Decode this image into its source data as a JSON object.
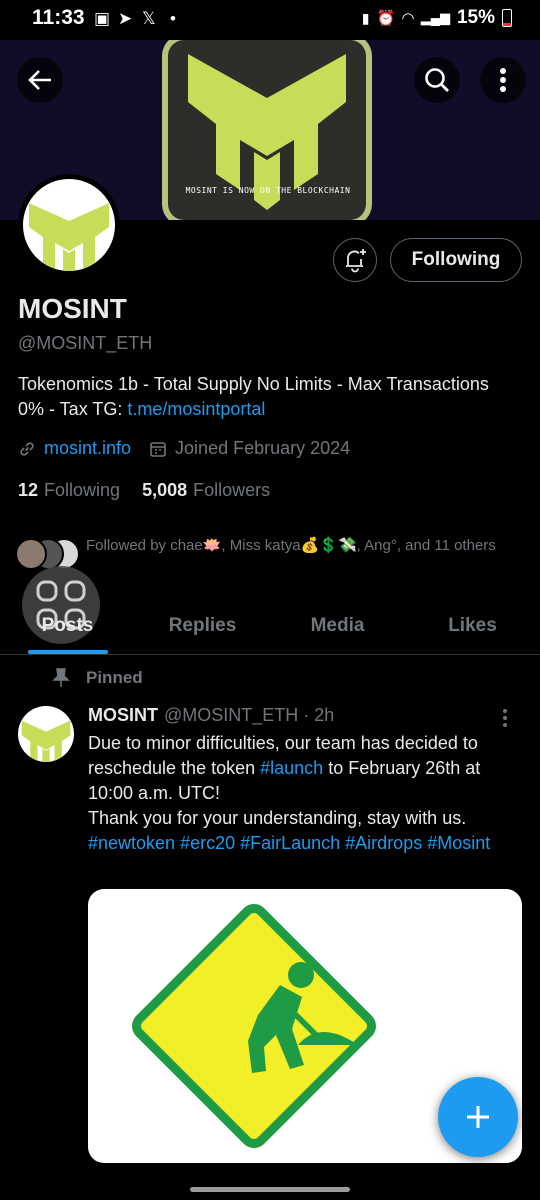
{
  "status_bar": {
    "time": "11:33",
    "battery": "15%"
  },
  "banner": {
    "tagline": "MOSINT IS NOW ON THE BLOCKCHAIN"
  },
  "profile": {
    "display_name": "MOSINT",
    "handle": "@MOSINT_ETH",
    "bio_text": "Tokenomics 1b - Total Supply No Limits - Max Transactions 0% - Tax TG: ",
    "bio_link": "t.me/mosintportal",
    "website": "mosint.info",
    "joined": "Joined February 2024",
    "following_count": "12",
    "following_label": "Following",
    "followers_count": "5,008",
    "followers_label": "Followers",
    "followed_by": "Followed by chae🪷, Miss katya💰💲💸, Ang°, and 11 others",
    "following_button": "Following"
  },
  "tabs": [
    {
      "label": "Posts",
      "active": true
    },
    {
      "label": "Replies",
      "active": false
    },
    {
      "label": "Media",
      "active": false
    },
    {
      "label": "Likes",
      "active": false
    }
  ],
  "post": {
    "pinned_label": "Pinned",
    "author_name": "MOSINT",
    "author_handle_time": "@MOSINT_ETH · 2h",
    "text_part1": "Due to minor difficulties, our team has decided to reschedule the token ",
    "hashtag_launch": "#launch",
    "text_part2": " to February 26th at 10:00 a.m. UTC!\nThank you for your understanding, stay with us.\n",
    "hashtags": "#newtoken #erc20 #FairLaunch #Airdrops #Mosint"
  },
  "colors": {
    "accent": "#1d9bf0",
    "brand_lime": "#c9dc5a",
    "sign_yellow": "#f2ee27",
    "sign_green": "#1f9a45"
  }
}
